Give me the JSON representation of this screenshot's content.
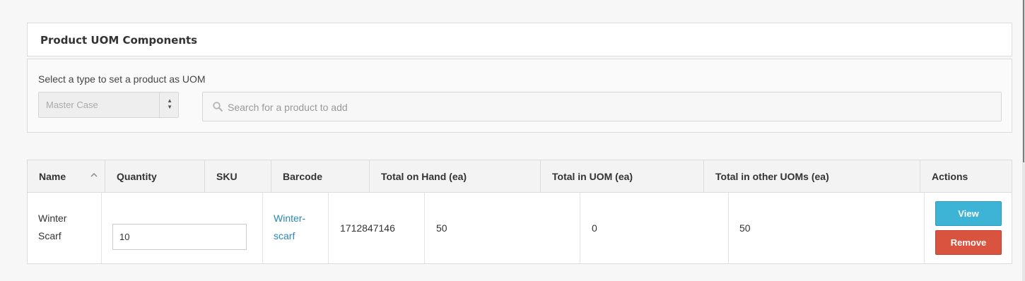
{
  "panel": {
    "title": "Product UOM Components",
    "type_label": "Select a type to set a product as UOM",
    "type_select_value": "Master Case",
    "search_placeholder": "Search for a product to add"
  },
  "table": {
    "headers": {
      "name": "Name",
      "quantity": "Quantity",
      "sku": "SKU",
      "barcode": "Barcode",
      "total_on_hand": "Total on Hand (ea)",
      "total_in_uom": "Total in UOM (ea)",
      "total_other_uoms": "Total in other UOMs (ea)",
      "actions": "Actions"
    },
    "rows": [
      {
        "name_line1": "Winter",
        "name_line2": "Scarf",
        "quantity": "10",
        "sku_line1": "Winter-",
        "sku_line2": "scarf",
        "barcode": "1712847146",
        "total_on_hand": "50",
        "total_in_uom": "0",
        "total_other_uoms": "50",
        "view_label": "View",
        "remove_label": "Remove"
      }
    ]
  },
  "icons": {
    "search": "search-icon",
    "sort": "chevron-up-icon",
    "select_arrows": "updown-arrows-icon"
  },
  "colors": {
    "link": "#2a87b8",
    "view_button": "#3db3d6",
    "remove_button": "#d9533f"
  }
}
